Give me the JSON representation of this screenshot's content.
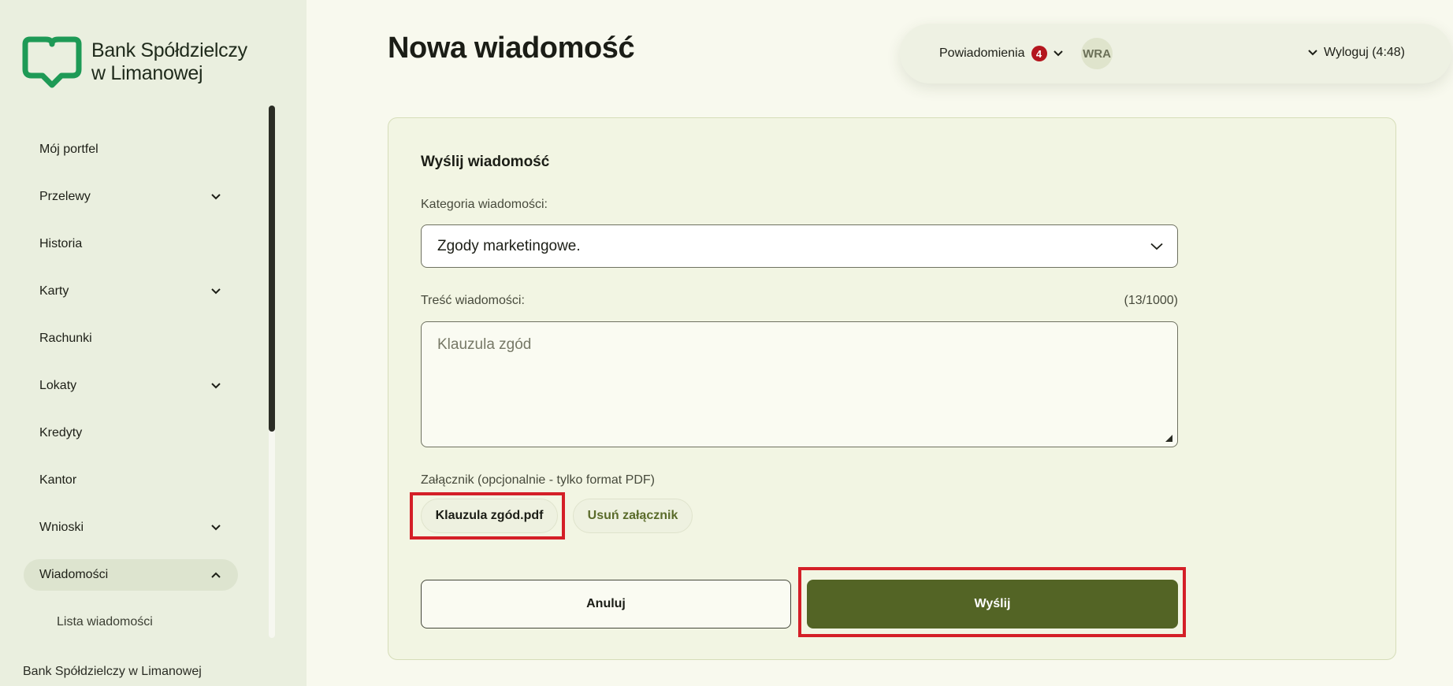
{
  "brand": {
    "name_line1": "Bank Spółdzielczy",
    "name_line2": "w Limanowej",
    "logo_color": "#1e9a56"
  },
  "sidebar": {
    "items": [
      {
        "label": "Mój portfel",
        "has_submenu": false
      },
      {
        "label": "Przelewy",
        "has_submenu": true
      },
      {
        "label": "Historia",
        "has_submenu": false
      },
      {
        "label": "Karty",
        "has_submenu": true
      },
      {
        "label": "Rachunki",
        "has_submenu": false
      },
      {
        "label": "Lokaty",
        "has_submenu": true
      },
      {
        "label": "Kredyty",
        "has_submenu": false
      },
      {
        "label": "Kantor",
        "has_submenu": false
      },
      {
        "label": "Wnioski",
        "has_submenu": true
      },
      {
        "label": "Wiadomości",
        "has_submenu": true,
        "expanded": true,
        "active": true
      }
    ],
    "subitems": [
      {
        "label": "Lista wiadomości"
      }
    ],
    "footer": "Bank Spółdzielczy w Limanowej"
  },
  "header": {
    "title": "Nowa wiadomość",
    "notifications_label": "Powiadomienia",
    "notifications_count": "4",
    "avatar_initials": "WRA",
    "logout_label": "Wyloguj (4:48)"
  },
  "form": {
    "title": "Wyślij wiadomość",
    "category_label": "Kategoria wiadomości:",
    "category_value": "Zgody marketingowe.",
    "content_label": "Treść wiadomości:",
    "content_counter": "(13/1000)",
    "content_value": "Klauzula zgód",
    "attachment_label": "Załącznik (opcjonalnie - tylko format PDF)",
    "attachment_file": "Klauzula zgód.pdf",
    "remove_attachment_label": "Usuń załącznik",
    "cancel_label": "Anuluj",
    "send_label": "Wyślij"
  },
  "colors": {
    "accent": "#536425",
    "highlight": "#d41f27",
    "badge": "#b4161e"
  }
}
